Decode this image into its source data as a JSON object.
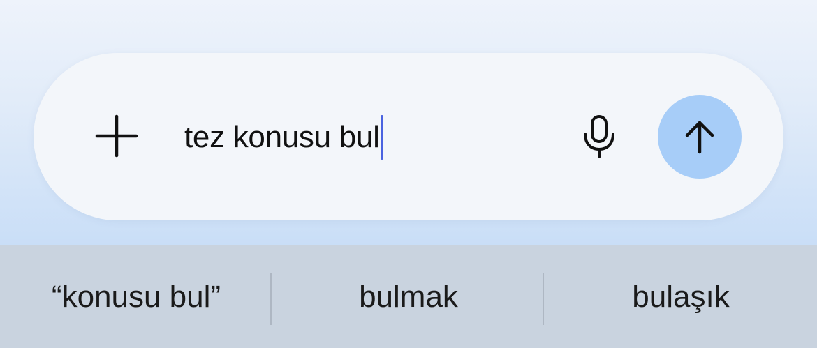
{
  "composer": {
    "input_value": "tez konusu bul",
    "icons": {
      "attach": "plus-icon",
      "voice": "microphone-icon",
      "send": "arrow-up-icon"
    },
    "colors": {
      "caret": "#4a63e0",
      "send_button": "#a7cdf8"
    }
  },
  "keyboard_suggestions": [
    {
      "label": "“konusu bul”"
    },
    {
      "label": "bulmak"
    },
    {
      "label": "bulaşık"
    }
  ]
}
